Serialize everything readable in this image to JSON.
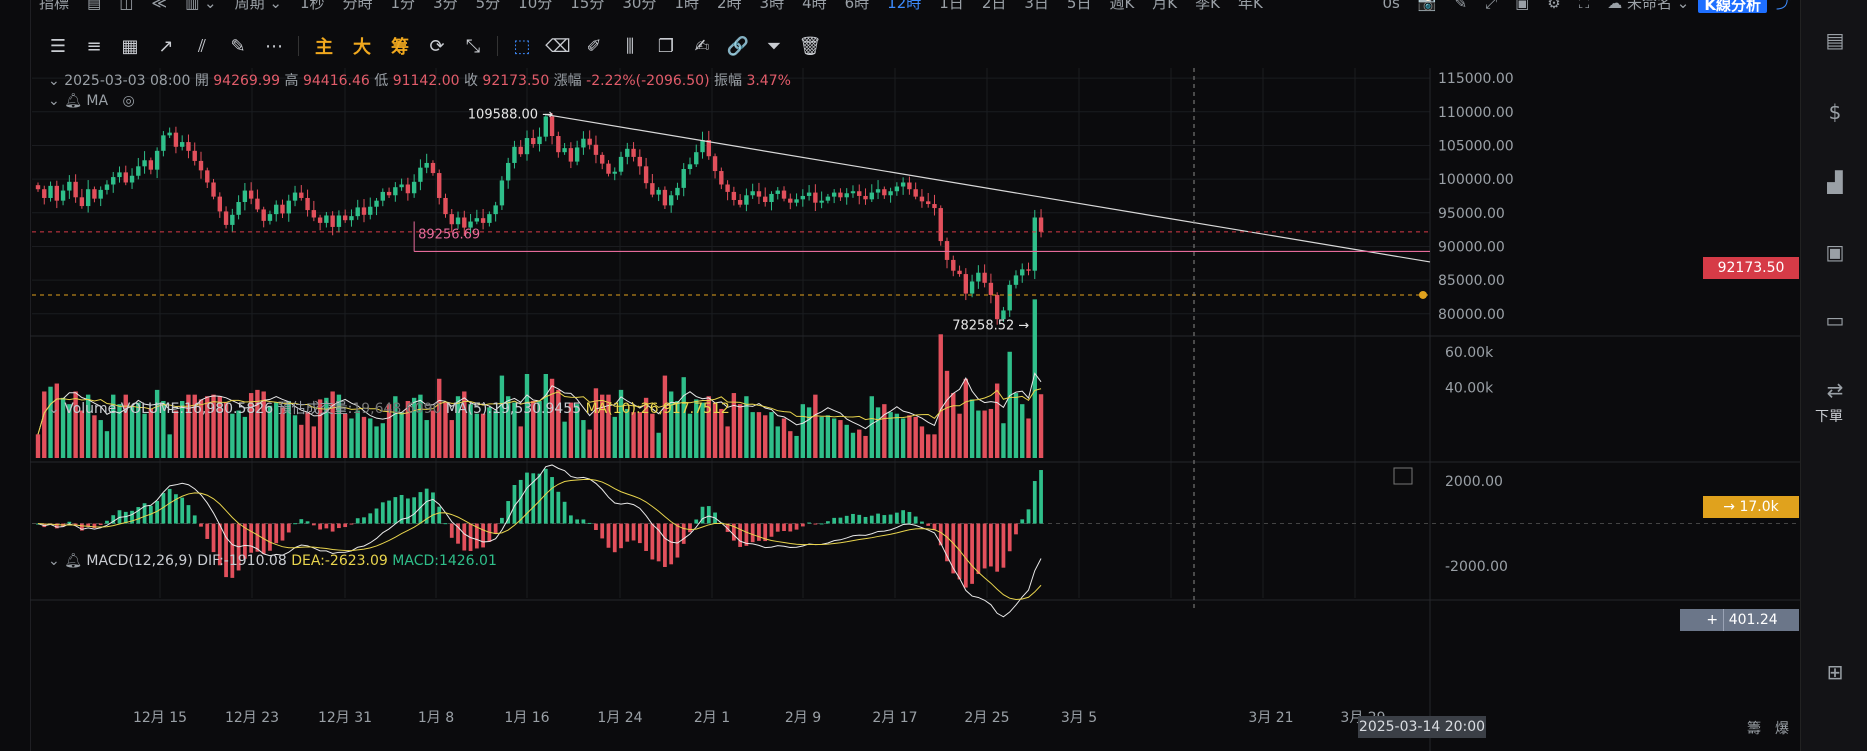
{
  "topbar": {
    "items": [
      "指標",
      "▤",
      "◫",
      "≪",
      "▥ ⌄",
      "周期 ⌄",
      "1秒",
      "分時",
      "1分",
      "3分",
      "5分",
      "10分",
      "15分",
      "30分",
      "1時",
      "2時",
      "3時",
      "4時",
      "6時",
      "12時",
      "1日",
      "2日",
      "3日",
      "5日",
      "週K",
      "月K",
      "季K",
      "年K"
    ],
    "active": "12時",
    "right": [
      "0s",
      "📷",
      "✎",
      "⤢",
      "▣",
      "⚙",
      "⛶",
      "☁ 未命名 ⌄"
    ],
    "kline_button": "K線分析",
    "share_icon": "share-icon"
  },
  "toolbar": {
    "icons": [
      "list-icon",
      "lines-icon",
      "ruler-icon",
      "trend-icon",
      "fib-icon",
      "pencil-icon",
      "more-icon"
    ],
    "text_buttons": [
      "主",
      "大",
      "筹"
    ],
    "icons2": [
      "refresh-icon",
      "measure-icon",
      "select-icon",
      "eraser-icon",
      "brush-icon",
      "candles-icon",
      "copy-icon",
      "note-icon",
      "link-icon",
      "filter-icon",
      "trash-icon"
    ]
  },
  "candle_info": {
    "date": "2025-03-03 08:00",
    "open_label": "開",
    "open": "94269.99",
    "high_label": "高",
    "high": "94416.46",
    "low_label": "低",
    "low": "91142.00",
    "close_label": "收",
    "close": "92173.50",
    "change_label": "漲幅",
    "change": "-2.22%(-2096.50)",
    "amp_label": "振幅",
    "amp": "3.47%"
  },
  "ma_label": "MA",
  "price_axis": [
    "115000.00",
    "110000.00",
    "105000.00",
    "100000.00",
    "95000.00",
    "90000.00",
    "85000.00",
    "80000.00"
  ],
  "current_price": "92173.50",
  "annotations": {
    "high": "109588.00 →",
    "low": "78258.52 →",
    "support": "89256.69"
  },
  "volume_info": {
    "title": "Volume",
    "vol": "VOLUME:16,980.5826",
    "est_label": "預估成交量:",
    "est": "19,648.6090",
    "ma5": "MA(5):19,530.9455",
    "ma10": "MA(10):26,917.7512"
  },
  "volume_axis": [
    "60.00k",
    "40.00k"
  ],
  "volume_current": "17.0k",
  "macd_info": {
    "title": "MACD(12,26,9)",
    "dif": "DIF:-1910.08",
    "dea": "DEA:-2623.09",
    "macd": "MACD:1426.01"
  },
  "macd_axis": [
    "2000.00",
    "-2000.00"
  ],
  "macd_current": "401.24",
  "date_axis": [
    "12月 15",
    "12月 23",
    "12月 31",
    "1月 8",
    "1月 16",
    "1月 24",
    "2月 1",
    "2月 9",
    "2月 17",
    "2月 25",
    "3月 5",
    "3月 21",
    "3月 29"
  ],
  "crosshair_date": "2025-03-14 20:00",
  "bottom_right": [
    "籌",
    "爆"
  ],
  "right_panel": {
    "order_label": "下單"
  },
  "colors": {
    "up": "#2fbf8a",
    "down": "#e2505c",
    "ma5": "#e8e8e8",
    "ma10": "#e8d44d",
    "price_box": "#d63b47",
    "volume_box": "#e0a21d",
    "macd_box": "#6b7689"
  },
  "chart_data": {
    "type": "candlestick",
    "interval": "12h",
    "ylim": [
      77000,
      116500
    ],
    "close_series": [
      98500,
      97200,
      99000,
      96800,
      98300,
      99600,
      97300,
      96000,
      98500,
      97100,
      98400,
      99200,
      100300,
      101000,
      99500,
      100500,
      101900,
      102800,
      101400,
      104200,
      106500,
      106900,
      104800,
      105500,
      104200,
      102700,
      101300,
      99500,
      97400,
      95200,
      93200,
      94700,
      96600,
      98300,
      97100,
      95500,
      93800,
      94800,
      96200,
      94900,
      96800,
      98000,
      97200,
      95400,
      94300,
      93500,
      94600,
      92900,
      94600,
      93900,
      94500,
      95800,
      94700,
      95900,
      96800,
      98100,
      97600,
      98800,
      99200,
      97900,
      99600,
      101700,
      102400,
      100900,
      97200,
      94800,
      93300,
      94300,
      92800,
      93700,
      94200,
      93500,
      94800,
      96100,
      99800,
      102400,
      104800,
      103700,
      106100,
      105200,
      106300,
      109300,
      106400,
      104000,
      104600,
      102600,
      104700,
      106000,
      105100,
      103600,
      102300,
      100800,
      101100,
      103300,
      104500,
      103300,
      101900,
      99400,
      97700,
      98400,
      96100,
      97600,
      98700,
      101500,
      102200,
      104000,
      105800,
      103400,
      101200,
      99200,
      98100,
      96900,
      96200,
      97600,
      98200,
      97400,
      96600,
      97800,
      98300,
      97100,
      96500,
      97000,
      97500,
      98000,
      96500,
      96800,
      97400,
      98000,
      97300,
      97900,
      98200,
      97500,
      97000,
      98000,
      98500,
      97600,
      98200,
      98900,
      99500,
      98500,
      97400,
      96700,
      96300,
      95700,
      90800,
      88000,
      86400,
      85900,
      83000,
      84800,
      86100,
      84600,
      82800,
      79200,
      80500,
      84300,
      85700,
      86600,
      86400,
      94300,
      92174
    ],
    "volume_ma5": [
      25000,
      22000,
      21000,
      20000,
      19000
    ],
    "volume_ma10": [
      27000,
      25000,
      24000,
      23000,
      22000
    ],
    "volume_last": 16980.5826,
    "macd_last": {
      "dif": -1910.08,
      "dea": -2623.09,
      "macd": 1426.01
    },
    "volume_ylim": [
      0,
      68000
    ],
    "macd_ylim": [
      -3500,
      2800
    ]
  }
}
